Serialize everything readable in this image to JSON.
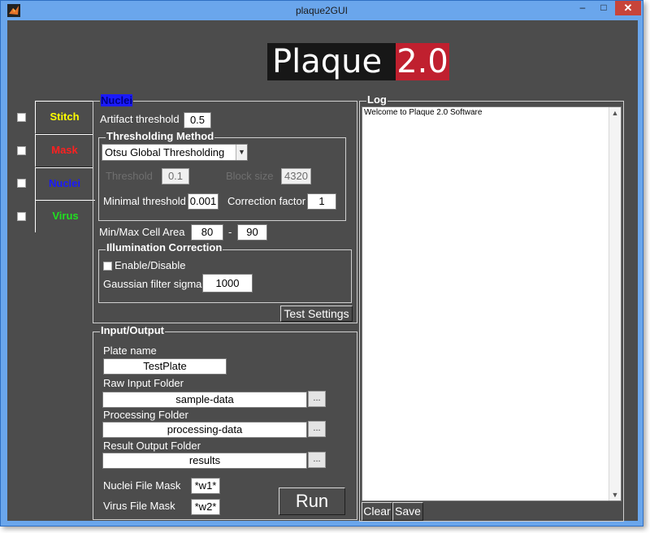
{
  "window": {
    "title": "plaque2GUI",
    "minimize": "–",
    "maximize": "□",
    "close": "✕"
  },
  "logo": {
    "word": "Plaque",
    "version": "2.0"
  },
  "tabs": [
    {
      "label": "Stitch",
      "color": "#ffff00"
    },
    {
      "label": "Mask",
      "color": "#ff2020"
    },
    {
      "label": "Nuclei",
      "color": "#1a1aff"
    },
    {
      "label": "Virus",
      "color": "#20e020"
    }
  ],
  "nuclei": {
    "title": "Nuclei",
    "artifact_threshold_label": "Artifact threshold",
    "artifact_threshold": "0.5",
    "thresholding": {
      "title": "Thresholding Method",
      "method": "Otsu Global Thresholding",
      "threshold_label": "Threshold",
      "threshold": "0.1",
      "block_size_label": "Block size",
      "block_size": "4320",
      "minimal_threshold_label": "Minimal threshold",
      "minimal_threshold": "0.001",
      "correction_factor_label": "Correction factor",
      "correction_factor": "1"
    },
    "cell_area_label": "Min/Max Cell Area",
    "cell_area_min": "80",
    "cell_area_sep": "-",
    "cell_area_max": "90",
    "illumination": {
      "title": "Illumination Correction",
      "enable_label": "Enable/Disable",
      "sigma_label": "Gaussian filter sigma",
      "sigma": "1000"
    },
    "test_settings": "Test Settings"
  },
  "io": {
    "title": "Input/Output",
    "plate_name_label": "Plate name",
    "plate_name": "TestPlate",
    "raw_input_label": "Raw Input Folder",
    "raw_input": "sample-data",
    "processing_label": "Processing Folder",
    "processing": "processing-data",
    "result_label": "Result Output Folder",
    "result": "results",
    "browse": "...",
    "nuclei_mask_label": "Nuclei File Mask",
    "nuclei_mask": "*w1*",
    "virus_mask_label": "Virus File Mask",
    "virus_mask": "*w2*",
    "run": "Run"
  },
  "log": {
    "title": "Log",
    "text": "Welcome to Plaque 2.0 Software",
    "clear": "Clear",
    "save": "Save"
  }
}
